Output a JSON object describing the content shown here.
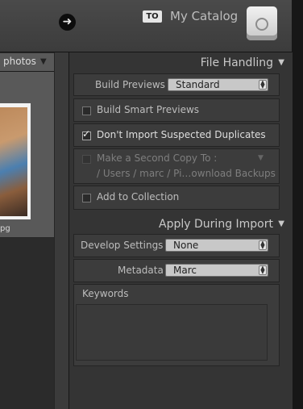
{
  "top_bar": {
    "to_badge": "TO",
    "catalog_name": "My Catalog"
  },
  "grid": {
    "toolbar_label": "photos",
    "thumbnail_caption": "pg"
  },
  "file_handling": {
    "title": "File Handling",
    "build_previews_label": "Build Previews",
    "build_previews_value": "Standard",
    "build_smart_previews": {
      "label": "Build Smart Previews",
      "checked": false
    },
    "dont_import_duplicates": {
      "label": "Don't Import Suspected Duplicates",
      "checked": true
    },
    "second_copy": {
      "label": "Make a Second Copy To :",
      "checked": false,
      "path": "/ Users / marc / Pi…ownload Backups"
    },
    "add_to_collection": {
      "label": "Add to Collection",
      "checked": false
    }
  },
  "apply_during_import": {
    "title": "Apply During Import",
    "develop_settings_label": "Develop Settings",
    "develop_settings_value": "None",
    "metadata_label": "Metadata",
    "metadata_value": "Marc",
    "keywords_label": "Keywords",
    "keywords_value": ""
  }
}
